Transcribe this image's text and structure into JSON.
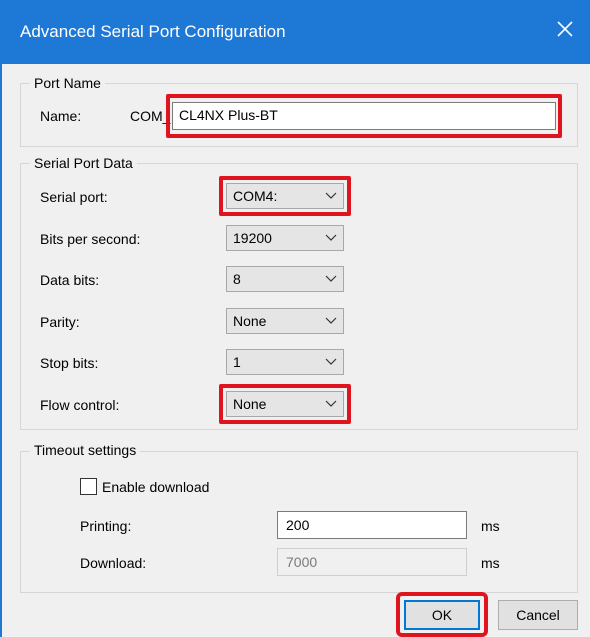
{
  "window": {
    "title": "Advanced Serial Port Configuration",
    "close_icon": "close-icon"
  },
  "port_name": {
    "legend": "Port Name",
    "name_label": "Name:",
    "prefix": "COM_",
    "value": "CL4NX Plus-BT"
  },
  "serial_port_data": {
    "legend": "Serial Port Data",
    "fields": [
      {
        "label": "Serial port:",
        "value": "COM4:"
      },
      {
        "label": "Bits per second:",
        "value": "19200"
      },
      {
        "label": "Data bits:",
        "value": "8"
      },
      {
        "label": "Parity:",
        "value": "None"
      },
      {
        "label": "Stop bits:",
        "value": "1"
      },
      {
        "label": "Flow control:",
        "value": "None"
      }
    ]
  },
  "timeout": {
    "legend": "Timeout settings",
    "enable_download_label": "Enable download",
    "enable_download_checked": false,
    "printing_label": "Printing:",
    "printing_value": "200",
    "printing_unit": "ms",
    "download_label": "Download:",
    "download_value": "7000",
    "download_unit": "ms"
  },
  "buttons": {
    "ok": "OK",
    "cancel": "Cancel"
  },
  "colors": {
    "titlebar": "#1e78d6",
    "highlight": "#e0141e"
  }
}
